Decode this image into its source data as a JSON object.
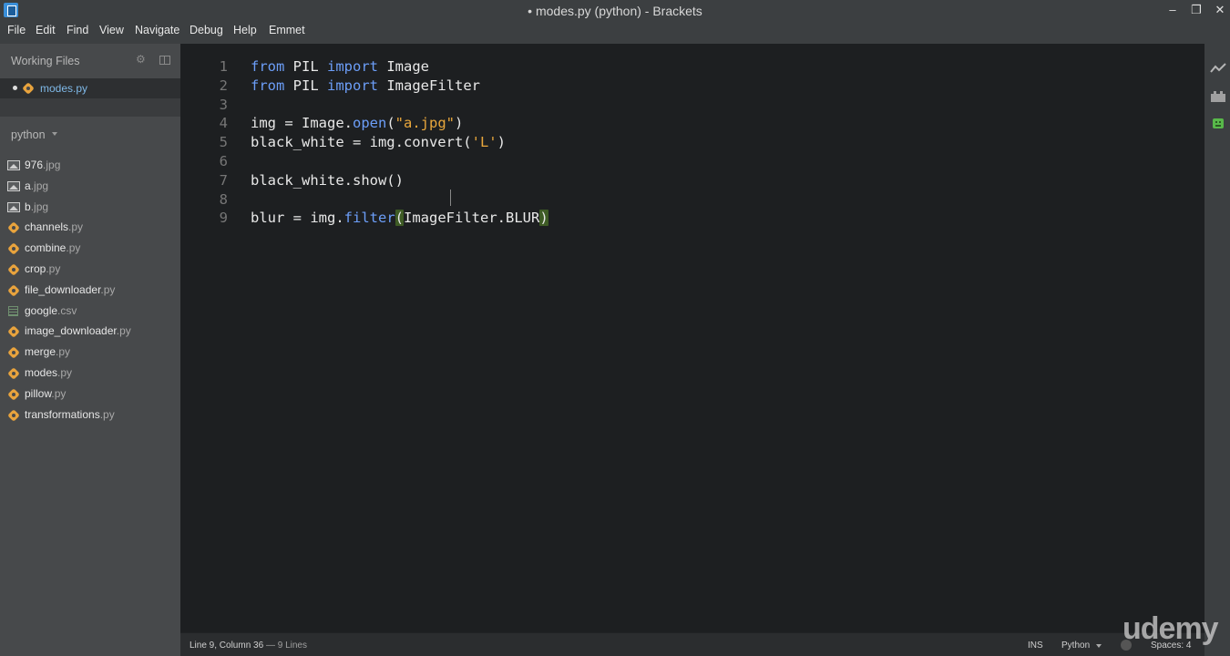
{
  "window": {
    "title": "• modes.py (python) - Brackets",
    "controls": [
      "minimize",
      "restore",
      "close"
    ]
  },
  "menu": [
    "File",
    "Edit",
    "Find",
    "View",
    "Navigate",
    "Debug",
    "Help",
    "Emmet"
  ],
  "sidebar": {
    "working_files_label": "Working Files",
    "working_file": "modes.py",
    "project": "python",
    "files": [
      {
        "name": "976",
        "ext": ".jpg",
        "icon": "image-file-icon"
      },
      {
        "name": "a",
        "ext": ".jpg",
        "icon": "image-file-icon"
      },
      {
        "name": "b",
        "ext": ".jpg",
        "icon": "image-file-icon"
      },
      {
        "name": "channels",
        "ext": ".py",
        "icon": "python-file-icon"
      },
      {
        "name": "combine",
        "ext": ".py",
        "icon": "python-file-icon"
      },
      {
        "name": "crop",
        "ext": ".py",
        "icon": "python-file-icon"
      },
      {
        "name": "file_downloader",
        "ext": ".py",
        "icon": "python-file-icon"
      },
      {
        "name": "google",
        "ext": ".csv",
        "icon": "csv-file-icon"
      },
      {
        "name": "image_downloader",
        "ext": ".py",
        "icon": "python-file-icon"
      },
      {
        "name": "merge",
        "ext": ".py",
        "icon": "python-file-icon"
      },
      {
        "name": "modes",
        "ext": ".py",
        "icon": "python-file-icon"
      },
      {
        "name": "pillow",
        "ext": ".py",
        "icon": "python-file-icon"
      },
      {
        "name": "transformations",
        "ext": ".py",
        "icon": "python-file-icon"
      }
    ]
  },
  "editor": {
    "lines": [
      {
        "n": "1",
        "tokens": [
          [
            "kw",
            "from"
          ],
          [
            "t",
            " PIL "
          ],
          [
            "kw",
            "import"
          ],
          [
            "t",
            " Image"
          ]
        ]
      },
      {
        "n": "2",
        "tokens": [
          [
            "kw",
            "from"
          ],
          [
            "t",
            " PIL "
          ],
          [
            "kw",
            "import"
          ],
          [
            "t",
            " ImageFilter"
          ]
        ]
      },
      {
        "n": "3",
        "tokens": []
      },
      {
        "n": "4",
        "tokens": [
          [
            "t",
            "img = Image."
          ],
          [
            "fn",
            "open"
          ],
          [
            "t",
            "("
          ],
          [
            "str",
            "\"a.jpg\""
          ],
          [
            "t",
            ")"
          ]
        ]
      },
      {
        "n": "5",
        "tokens": [
          [
            "t",
            "black_white = img.convert("
          ],
          [
            "str",
            "'L'"
          ],
          [
            "t",
            ")"
          ]
        ]
      },
      {
        "n": "6",
        "tokens": []
      },
      {
        "n": "7",
        "tokens": [
          [
            "t",
            "black_white.show()"
          ]
        ]
      },
      {
        "n": "8",
        "tokens": []
      },
      {
        "n": "9",
        "tokens": [
          [
            "t",
            "blur = img."
          ],
          [
            "fn",
            "filter"
          ],
          [
            "hl",
            "("
          ],
          [
            "t",
            "ImageFilter.BLUR"
          ],
          [
            "hl",
            ")"
          ]
        ]
      }
    ]
  },
  "status": {
    "position": "Line 9, Column 36",
    "lines": " — 9 Lines",
    "mode": "INS",
    "language": "Python",
    "spaces": "Spaces: 4"
  },
  "watermark": "udemy",
  "colors": {
    "keyword": "#6c9ef8",
    "string": "#e9a73c",
    "bracket_match": "#3e5b25",
    "python_icon": "#e8a33d"
  }
}
